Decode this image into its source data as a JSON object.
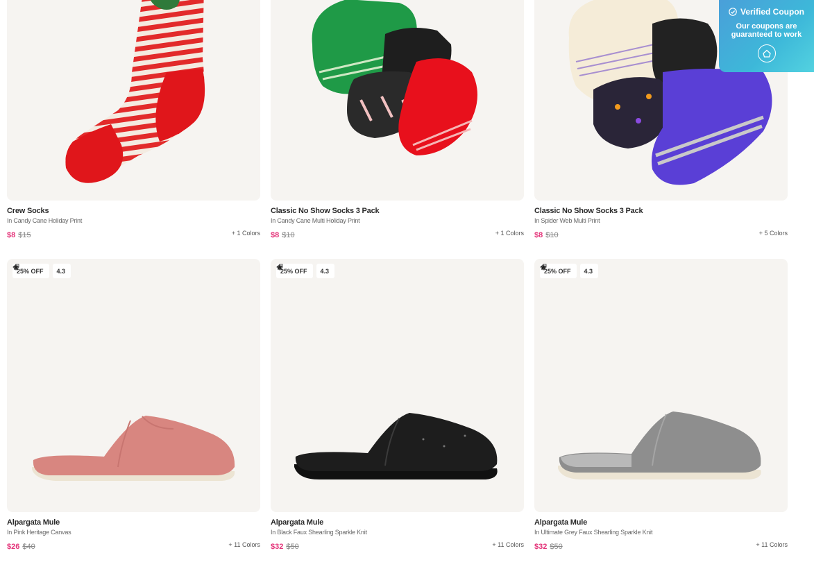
{
  "products": [
    {
      "name": "Crew Socks",
      "variant": "In Candy Cane Holiday Print",
      "price": "$8",
      "original_price": "$15",
      "colors": "+ 1 Colors"
    },
    {
      "name": "Classic No Show Socks 3 Pack",
      "variant": "In Candy Cane Multi Holiday Print",
      "price": "$8",
      "original_price": "$10",
      "colors": "+ 1 Colors"
    },
    {
      "name": "Classic No Show Socks 3 Pack",
      "variant": "In Spider Web Multi Print",
      "price": "$8",
      "original_price": "$10",
      "colors": "+ 5 Colors"
    },
    {
      "name": "Alpargata Mule",
      "variant": "In Pink Heritage Canvas",
      "price": "$26",
      "original_price": "$40",
      "colors": "+ 11 Colors",
      "discount": "25% OFF",
      "rating": "4.3"
    },
    {
      "name": "Alpargata Mule",
      "variant": "In Black Faux Shearling Sparkle Knit",
      "price": "$32",
      "original_price": "$50",
      "colors": "+ 11 Colors",
      "discount": "25% OFF",
      "rating": "4.3"
    },
    {
      "name": "Alpargata Mule",
      "variant": "In Ultimate Grey Faux Shearling Sparkle Knit",
      "price": "$32",
      "original_price": "$50",
      "colors": "+ 11 Colors",
      "discount": "25% OFF",
      "rating": "4.3"
    }
  ],
  "coupon": {
    "title": "Verified Coupon",
    "subtitle": "Our coupons are guaranteed to work"
  },
  "icons": {
    "tag": "tag-icon",
    "star": "star-icon",
    "check": "check-circle-icon",
    "coupon_logo": "coupon-logo-icon"
  },
  "colors": {
    "sale_price": "#e4357a",
    "coupon_bg": "#3db8d9"
  }
}
